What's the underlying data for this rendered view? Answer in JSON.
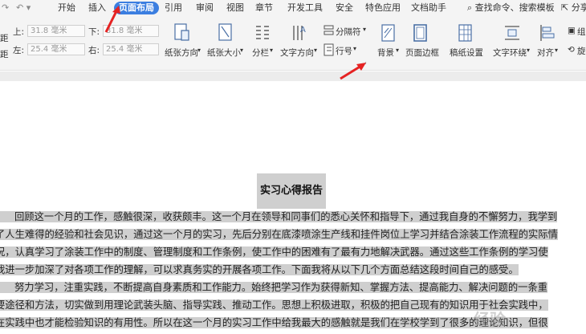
{
  "menu": {
    "tabs": [
      {
        "label": "开始"
      },
      {
        "label": "插入"
      },
      {
        "label": "页面布局"
      },
      {
        "label": "引用"
      },
      {
        "label": "审阅"
      },
      {
        "label": "视图"
      },
      {
        "label": "章节"
      },
      {
        "label": "开发工具"
      },
      {
        "label": "安全"
      },
      {
        "label": "特色应用"
      },
      {
        "label": "文档助手"
      }
    ],
    "search_text": "查找命令、搜索模板",
    "share_label": "分享"
  },
  "ribbon": {
    "margin_top_label": "上:",
    "margin_top_value": "31.8 毫米",
    "margin_bottom_label": "下:",
    "margin_bottom_value": "31.8 毫米",
    "margin_left_label": "左:",
    "margin_left_value": "25.4 毫米",
    "margin_right_label": "右:",
    "margin_right_value": "25.4 毫米",
    "margin_side_label_a": "距",
    "margin_side_label_b": "距",
    "orientation": "纸张方向",
    "size": "纸张大小",
    "columns": "分栏",
    "text_direction": "文字方向",
    "separator": "分隔符",
    "line_number": "行号",
    "background": "背景",
    "page_border": "页面边框",
    "grid_settings": "稿纸设置",
    "text_wrap": "文字环绕",
    "align": "对齐",
    "rotate_short": "旋",
    "combine_short": "组"
  },
  "document": {
    "title": "实习心得报告",
    "lines": [
      "回顾这一个月的工作，感触很深，收获颇丰。这一个月在领导和同事们的悉心关怀和指导下，通过我自身的不懈努力，我学到",
      "了人生难得的经验和社会见识，通过这一个月的实习，先后分别在底漆喷涂生产线和挂件岗位上学习并结合涂装工作流程的实际情",
      "况，认真学习了涂装工作中的制度、管理制度和工作条例，使工作中的困难有了最有力地解决武器。通过这些工作条例的学习使",
      "我进一步加深了对各项工作的理解，可以求真务实的开展各项工作。下面我将从以下几个方面总结这段时间自己的感受。",
      "努力学习，注重实践，不断提高自身素质和工作能力。始终把学习作为获得新知、掌握方法、提高能力、解决问题的一条重",
      "要途径和方法，切实做到用理论武装头脑、指导实践、推动工作。思想上积极进取，积极的把自己现有的知识用于社会实践中，",
      "在实践中也才能检验知识的有用性。所以在这一个月的实习工作中给我最大的感触就是我们在学校学到了很多的理论知识，但很"
    ]
  },
  "watermark": "经验"
}
